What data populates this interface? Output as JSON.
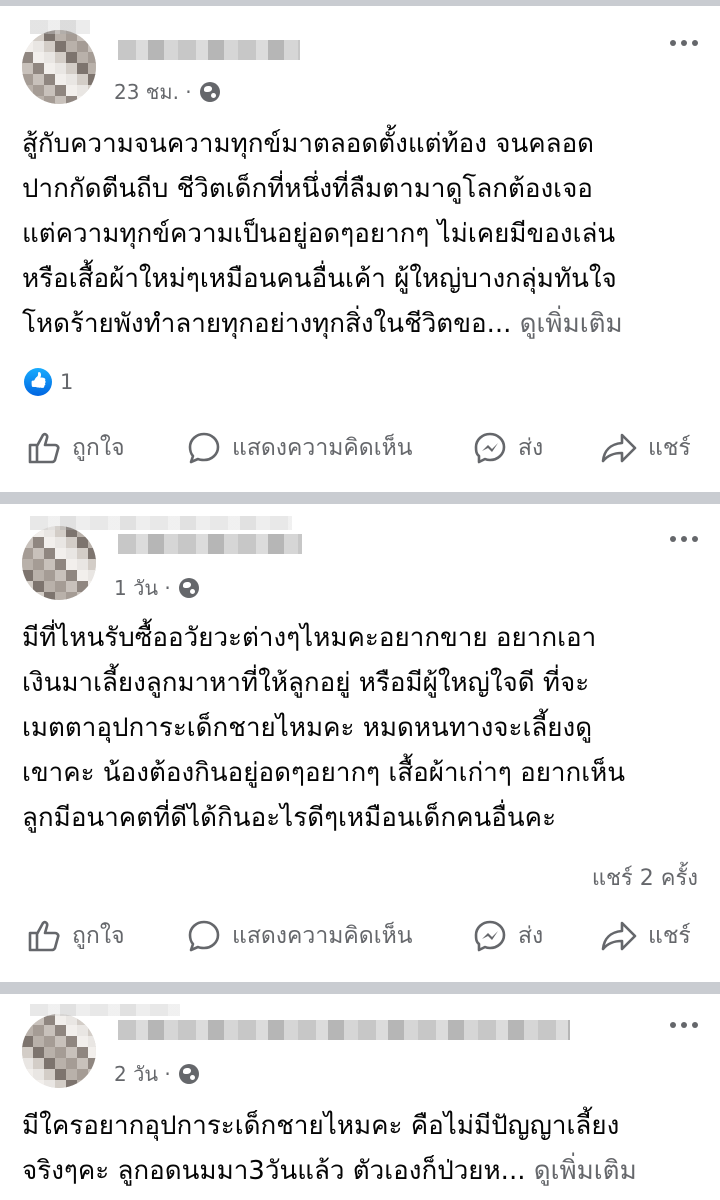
{
  "posts": [
    {
      "time": "23 ชม. ·",
      "text_lines": [
        "สู้กับความจนความทุกข์มาตลอดตั้งแต่ท้อง จนคลอด",
        "ปากกัดตีนถีบ ชีวิตเด็กที่หนึ่งที่ลืมตามาดูโลกต้องเจอ",
        "แต่ความทุกข์ความเป็นอยู่อดๆอยากๆ ไม่เคยมีของเล่น",
        "หรือเสื้อผ้าใหม่ๆเหมือนคนอื่นเค้า ผู้ใหญ่บางกลุ่มทันใจ",
        "โหดร้ายพังทำลายทุกอย่างทุกสิ่งในชีวิตขอ... "
      ],
      "see_more": "ดูเพิ่มเติม",
      "reaction_count": "1",
      "share_count": ""
    },
    {
      "time": "1 วัน ·",
      "text_lines": [
        "มีที่ไหนรับซื้ออวัยวะต่างๆไหมคะอยากขาย อยากเอา",
        "เงินมาเลี้ยงลูกมาหาที่ให้ลูกอยู่ หรือมีผู้ใหญ่ใจดี ที่จะ",
        "เมตตาอุปการะเด็กชายไหมคะ หมดหนทางจะเลี้ยงดู",
        "เขาคะ น้องต้องกินอยู่อดๆอยากๆ เสื้อผ้าเก่าๆ อยากเห็น",
        "ลูกมีอนาคตที่ดีได้กินอะไรดีๆเหมือนเด็กคนอื่นคะ"
      ],
      "see_more": "",
      "reaction_count": "",
      "share_count": "แชร์ 2 ครั้ง"
    },
    {
      "time": "2 วัน ·",
      "text_lines": [
        "มีใครอยากอุปการะเด็กชายไหมคะ คือไม่มีปัญญาเลี้ยง",
        "จริงๆคะ ลูกอดนมมา3วันแล้ว ตัวเองก็ป่วยห... "
      ],
      "see_more": "ดูเพิ่มเติม",
      "reaction_count": "",
      "share_count": ""
    }
  ],
  "actions": {
    "like": "ถูกใจ",
    "comment": "แสดงความคิดเห็น",
    "send": "ส่ง",
    "share": "แชร์"
  },
  "icons": {
    "like": "thumbs-up-icon",
    "comment": "comment-bubble-icon",
    "send": "messenger-icon",
    "share": "share-arrow-icon",
    "more": "more-dots-icon",
    "privacy": "globe-icon"
  },
  "colors": {
    "text": "#050505",
    "secondary": "#65676b",
    "separator": "#c9ccd1",
    "like_blue": "#1877f2"
  }
}
